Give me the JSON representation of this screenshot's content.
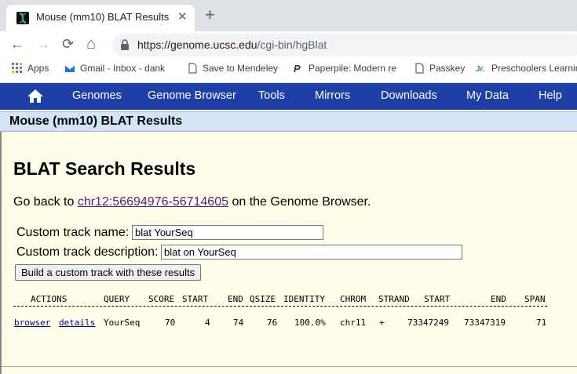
{
  "browser": {
    "tab_title": "Mouse (mm10) BLAT Results",
    "tab_close": "✕",
    "new_tab": "+",
    "url_domain": "https://genome.ucsc.edu",
    "url_path": "/cgi-bin/hgBlat",
    "nav": {
      "back": "←",
      "forward": "→",
      "reload": "⟳",
      "home": "⌂"
    }
  },
  "bookmarks": [
    {
      "label": "Apps",
      "icon": "apps-grid-icon"
    },
    {
      "label": "Gmail - Inbox - dank",
      "icon": "gmail-icon"
    },
    {
      "label": "Save to Mendeley",
      "icon": "document-icon"
    },
    {
      "label": "Paperpile: Modern re",
      "icon": "paperpile-icon"
    },
    {
      "label": "Passkey",
      "icon": "document-icon"
    },
    {
      "label": "Preschoolers Learnin",
      "icon": "jr-icon"
    }
  ],
  "site_nav": {
    "items": [
      "Genomes",
      "Genome Browser",
      "Tools",
      "Mirrors",
      "Downloads",
      "My Data",
      "Help"
    ],
    "home_icon": "home-icon",
    "color": "#1c3fa8"
  },
  "page": {
    "band_title": "Mouse (mm10) BLAT Results",
    "heading": "BLAT Search Results",
    "goback_prefix": "Go back to ",
    "goback_link": "chr12:56694976-56714605",
    "goback_suffix": " on the Genome Browser.",
    "track_name_label": "Custom track name:",
    "track_name_value": "blat YourSeq",
    "track_desc_label": "Custom track description:",
    "track_desc_value": "blat on YourSeq",
    "build_button": "Build a custom track with these results"
  },
  "results": {
    "columns": [
      "ACTIONS",
      "QUERY",
      "SCORE",
      "START",
      "END",
      "QSIZE",
      "IDENTITY",
      "CHROM",
      "STRAND",
      "START",
      "END",
      "SPAN"
    ],
    "rows": [
      {
        "browser": "browser",
        "details": "details",
        "query": "YourSeq",
        "score": "70",
        "qstart": "4",
        "qend": "74",
        "qsize": "76",
        "identity": "100.0%",
        "chrom": "chr11",
        "strand": "+",
        "tstart": "73347249",
        "tend": "73347319",
        "span": "71"
      }
    ]
  }
}
